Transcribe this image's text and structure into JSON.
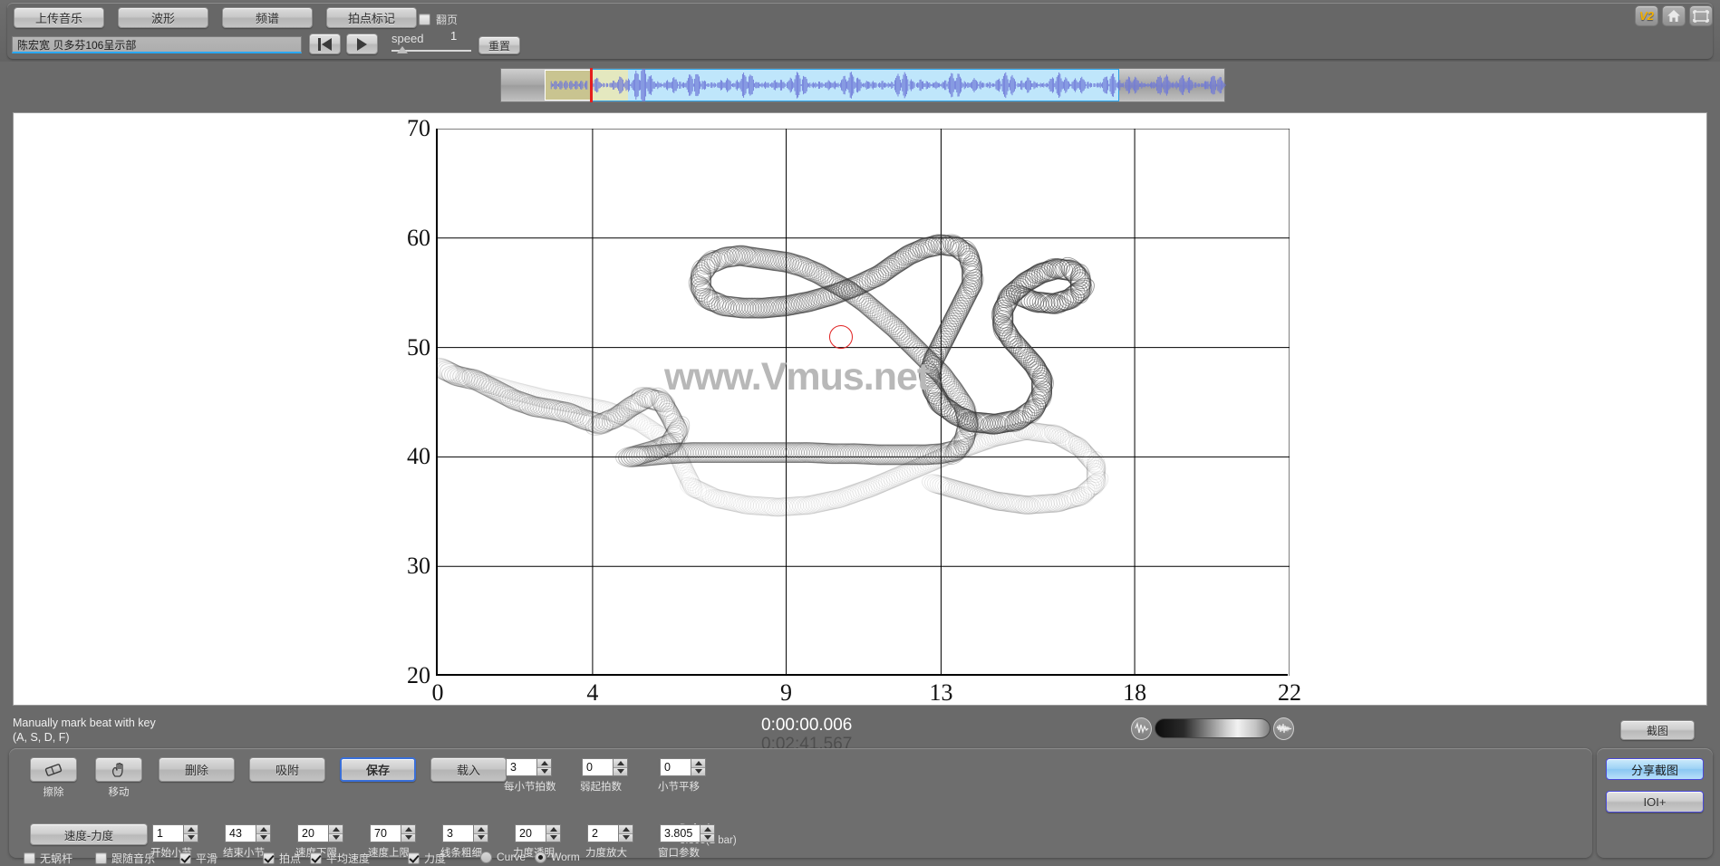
{
  "app": {
    "watermark": "www.Vmus.net"
  },
  "toolbar": {
    "upload_label": "上传音乐",
    "waveform_label": "波形",
    "spectrum_label": "频谱",
    "beatmark_label": "拍点标记",
    "pageturn_label": "翻页",
    "pageturn_checked": false,
    "title_value": "陈宏宽 贝多芬106呈示部",
    "title_placeholder": "",
    "speed_label": "speed",
    "speed_value": "1",
    "reset_label": "重置",
    "badge_v2": "V2",
    "icons": [
      "v2-badge",
      "home-icon",
      "fullscreen-icon"
    ]
  },
  "chart_data": {
    "type": "scatter",
    "title": "",
    "xlabel": "",
    "ylabel": "",
    "xticks": [
      0,
      4,
      9,
      13,
      18,
      22
    ],
    "yticks": [
      20,
      30,
      40,
      50,
      60,
      70
    ],
    "xlim": [
      0,
      22
    ],
    "ylim": [
      20,
      70
    ],
    "grid": true,
    "render_mode": "Worm",
    "marker_circle": {
      "x": 10.1,
      "y": 49.9,
      "color": "#e02020"
    },
    "series": [
      {
        "name": "tempo-dynamics-worm",
        "points": [
          [
            0.15,
            48.0
          ],
          [
            0.5,
            47.4
          ],
          [
            1.0,
            47.0
          ],
          [
            1.5,
            46.1
          ],
          [
            2.0,
            45.2
          ],
          [
            2.5,
            44.6
          ],
          [
            3.0,
            44.3
          ],
          [
            3.4,
            44.0
          ],
          [
            3.8,
            43.4
          ],
          [
            4.2,
            43.0
          ],
          [
            4.6,
            43.6
          ],
          [
            5.0,
            44.6
          ],
          [
            5.4,
            45.4
          ],
          [
            5.8,
            45.0
          ],
          [
            6.0,
            43.8
          ],
          [
            6.2,
            42.4
          ],
          [
            6.0,
            41.2
          ],
          [
            5.6,
            40.6
          ],
          [
            5.2,
            40.2
          ],
          [
            5.0,
            40.0
          ],
          [
            5.4,
            40.1
          ],
          [
            6.0,
            40.3
          ],
          [
            6.6,
            40.4
          ],
          [
            7.2,
            40.4
          ],
          [
            7.8,
            40.4
          ],
          [
            8.4,
            40.4
          ],
          [
            9.0,
            40.4
          ],
          [
            9.6,
            40.4
          ],
          [
            10.2,
            40.3
          ],
          [
            10.8,
            40.3
          ],
          [
            11.4,
            40.2
          ],
          [
            12.0,
            40.2
          ],
          [
            12.6,
            40.2
          ],
          [
            13.0,
            40.3
          ],
          [
            13.4,
            40.6
          ],
          [
            13.6,
            41.6
          ],
          [
            13.7,
            43.0
          ],
          [
            13.6,
            44.6
          ],
          [
            13.3,
            46.2
          ],
          [
            13.0,
            47.6
          ],
          [
            12.6,
            49.0
          ],
          [
            12.2,
            50.4
          ],
          [
            11.8,
            51.8
          ],
          [
            11.4,
            53.0
          ],
          [
            11.0,
            54.2
          ],
          [
            10.6,
            55.2
          ],
          [
            10.2,
            56.0
          ],
          [
            9.8,
            56.8
          ],
          [
            9.4,
            57.4
          ],
          [
            9.0,
            57.8
          ],
          [
            8.6,
            58.0
          ],
          [
            8.2,
            58.2
          ],
          [
            7.8,
            58.4
          ],
          [
            7.4,
            58.2
          ],
          [
            7.0,
            57.6
          ],
          [
            6.8,
            56.6
          ],
          [
            6.8,
            55.4
          ],
          [
            7.0,
            54.4
          ],
          [
            7.4,
            53.8
          ],
          [
            7.9,
            53.6
          ],
          [
            8.4,
            53.6
          ],
          [
            9.0,
            53.8
          ],
          [
            9.6,
            54.2
          ],
          [
            10.2,
            54.8
          ],
          [
            10.8,
            55.6
          ],
          [
            11.4,
            56.6
          ],
          [
            11.8,
            57.6
          ],
          [
            12.2,
            58.5
          ],
          [
            12.6,
            59.1
          ],
          [
            13.0,
            59.4
          ],
          [
            13.4,
            59.2
          ],
          [
            13.7,
            58.4
          ],
          [
            13.8,
            57.2
          ],
          [
            13.8,
            55.8
          ],
          [
            13.6,
            54.4
          ],
          [
            13.4,
            53.0
          ],
          [
            13.2,
            51.6
          ],
          [
            13.0,
            50.2
          ],
          [
            12.8,
            48.8
          ],
          [
            12.7,
            47.4
          ],
          [
            12.8,
            46.0
          ],
          [
            13.0,
            44.8
          ],
          [
            13.4,
            43.8
          ],
          [
            13.8,
            43.2
          ],
          [
            14.4,
            43.0
          ],
          [
            15.0,
            43.4
          ],
          [
            15.4,
            44.4
          ],
          [
            15.6,
            45.8
          ],
          [
            15.6,
            47.2
          ],
          [
            15.4,
            48.4
          ],
          [
            15.1,
            49.6
          ],
          [
            14.8,
            50.8
          ],
          [
            14.6,
            52.0
          ],
          [
            14.6,
            53.4
          ],
          [
            14.8,
            54.8
          ],
          [
            15.2,
            56.0
          ],
          [
            15.6,
            56.8
          ],
          [
            16.0,
            57.2
          ],
          [
            16.4,
            57.0
          ],
          [
            16.6,
            56.2
          ],
          [
            16.6,
            55.2
          ],
          [
            16.3,
            54.4
          ],
          [
            15.9,
            54.0
          ],
          [
            15.4,
            54.2
          ],
          [
            15.0,
            54.8
          ]
        ]
      },
      {
        "name": "secondary-worm",
        "points": [
          [
            0.4,
            47.6
          ],
          [
            1.2,
            46.8
          ],
          [
            2.0,
            46.0
          ],
          [
            2.8,
            45.3
          ],
          [
            3.6,
            44.8
          ],
          [
            4.4,
            44.2
          ],
          [
            5.2,
            43.2
          ],
          [
            5.8,
            41.8
          ],
          [
            6.2,
            40.2
          ],
          [
            6.4,
            38.6
          ],
          [
            6.6,
            37.2
          ],
          [
            7.2,
            36.2
          ],
          [
            8.0,
            35.6
          ],
          [
            8.8,
            35.4
          ],
          [
            9.6,
            35.6
          ],
          [
            10.4,
            36.2
          ],
          [
            11.2,
            37.2
          ],
          [
            12.0,
            38.4
          ],
          [
            12.8,
            39.6
          ],
          [
            13.6,
            40.8
          ],
          [
            14.4,
            41.8
          ],
          [
            15.2,
            42.4
          ],
          [
            16.0,
            42.0
          ],
          [
            16.6,
            40.8
          ],
          [
            17.0,
            39.2
          ],
          [
            17.0,
            37.6
          ],
          [
            16.6,
            36.4
          ],
          [
            16.0,
            35.8
          ],
          [
            15.2,
            35.6
          ],
          [
            14.4,
            36.0
          ],
          [
            13.6,
            36.8
          ],
          [
            12.8,
            37.6
          ]
        ]
      }
    ]
  },
  "status": {
    "hint": "Manually mark beat with key\n(A, S, D, F)",
    "time_current": "0:00:00.006",
    "time_total": "0:02:41.567",
    "screenshot_label": "截图",
    "share_label": "分享截图",
    "ioi_label": "IOI+"
  },
  "editor": {
    "tools": [
      {
        "name": "erase",
        "label": "擦除",
        "icon": "eraser-icon"
      },
      {
        "name": "move",
        "label": "移动",
        "icon": "hand-icon"
      }
    ],
    "delete_label": "删除",
    "snap_label": "吸附",
    "save_label": "保存",
    "load_label": "载入",
    "speeddyn_label": "速度-力度",
    "default_note": "Default:\n3.805(1 bar)"
  },
  "spinners_row1": [
    {
      "name": "beats-per-bar",
      "value": "3",
      "label": "每小节拍数"
    },
    {
      "name": "pickup-beats",
      "value": "0",
      "label": "弱起拍数"
    },
    {
      "name": "bar-shift",
      "value": "0",
      "label": "小节平移"
    }
  ],
  "spinners_row2": [
    {
      "name": "start-bar",
      "value": "1",
      "label": "开始小节"
    },
    {
      "name": "end-bar",
      "value": "43",
      "label": "结束小节"
    },
    {
      "name": "tempo-min",
      "value": "20",
      "label": "速度下限"
    },
    {
      "name": "tempo-max",
      "value": "70",
      "label": "速度上限"
    },
    {
      "name": "line-thickness",
      "value": "3",
      "label": "线条粗细"
    },
    {
      "name": "dynamics-alpha",
      "value": "20",
      "label": "力度透明"
    },
    {
      "name": "dynamics-scale",
      "value": "2",
      "label": "力度放大"
    },
    {
      "name": "window-param",
      "value": "3.805",
      "label": "窗口参数"
    }
  ],
  "checkboxes": [
    {
      "name": "no-vibrato",
      "label": "无蜗杆",
      "checked": false
    },
    {
      "name": "follow-music",
      "label": "跟随音乐",
      "checked": false
    },
    {
      "name": "smooth",
      "label": "平滑",
      "checked": true
    },
    {
      "name": "beatpoint",
      "label": "拍点",
      "checked": true
    },
    {
      "name": "avg-tempo",
      "label": "平均速度",
      "checked": true
    },
    {
      "name": "dynamics",
      "label": "力度",
      "checked": true
    }
  ],
  "radios": [
    {
      "name": "curve",
      "label": "Curve",
      "selected": false
    },
    {
      "name": "worm",
      "label": "Worm",
      "selected": true
    }
  ],
  "colors": {
    "accent_blue": "#2aa8f2",
    "selection": "#bfe6fb",
    "cursor_red": "#e51d1d",
    "badge_yellow": "#f4b000",
    "panel_bg": "#6e6e6e"
  }
}
